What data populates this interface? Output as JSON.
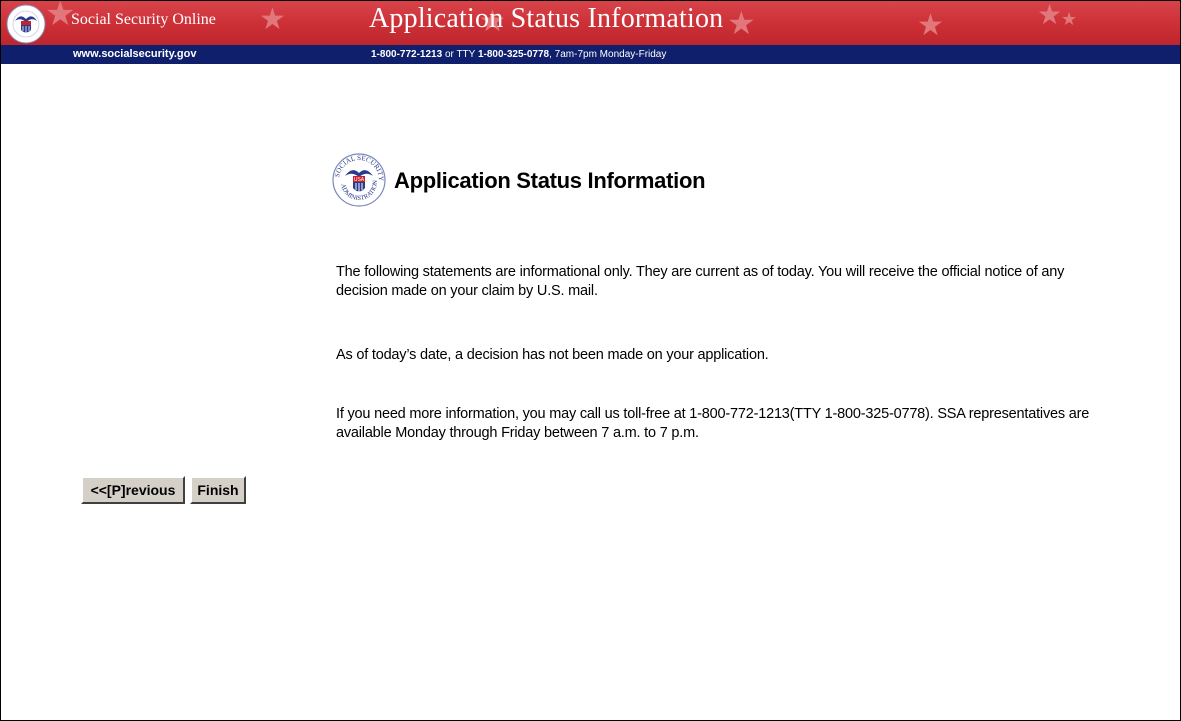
{
  "header": {
    "site_name": "Social Security Online",
    "title": "Application Status Information",
    "url": "www.socialsecurity.gov",
    "phone": {
      "main": "1-800-772-1213",
      "or_text": " or TTY ",
      "tty": "1-800-325-0778",
      "hours": ", 7am-7pm Monday-Friday"
    },
    "colors": {
      "red": "#cc2f36",
      "blue": "#0f1f6b"
    }
  },
  "logo": {
    "top_text": "SOCIAL SECURITY",
    "bottom_text": "ADMINISTRATION",
    "shield_text": "USA"
  },
  "main": {
    "title": "Application Status Information",
    "paragraphs": [
      "The following statements are informational only. They are current as of today. You will receive the official notice of any decision made on your claim by U.S. mail.",
      "As of today’s date, a decision has not been made on your application.",
      "If you need more information, you may call us toll-free at 1-800-772-1213(TTY 1-800-325-0778). SSA representatives are available Monday through Friday between 7 a.m. to 7 p.m."
    ]
  },
  "buttons": {
    "previous_label": "<<[P]revious",
    "finish_label": "Finish"
  }
}
